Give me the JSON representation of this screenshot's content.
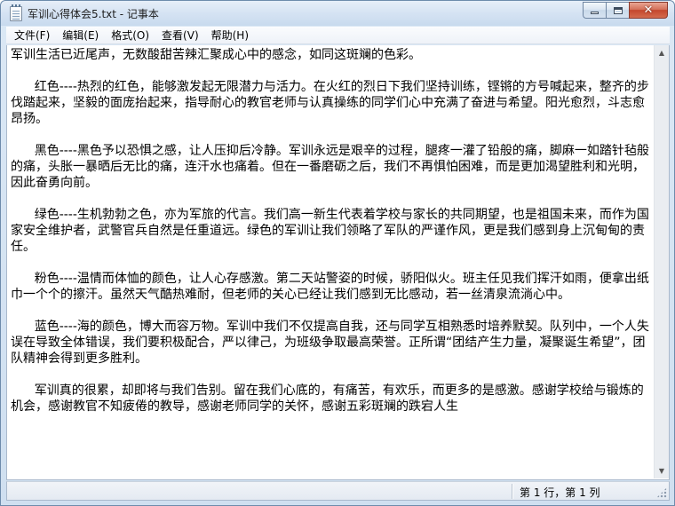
{
  "window": {
    "title": "军训心得体会5.txt - 记事本",
    "icon": "notepad-icon",
    "buttons": {
      "minimize": "minimize-icon",
      "maximize": "maximize-icon",
      "close": "close-icon"
    },
    "close_color": "#c4472d"
  },
  "menu": [
    {
      "label": "文件(F)"
    },
    {
      "label": "编辑(E)"
    },
    {
      "label": "格式(O)"
    },
    {
      "label": "查看(V)"
    },
    {
      "label": "帮助(H)"
    }
  ],
  "document": {
    "paragraphs": [
      "军训生活已近尾声，无数酸甜苦辣汇聚成心中的感念，如同这斑斓的色彩。",
      "      红色----热烈的红色，能够激发起无限潜力与活力。在火红的烈日下我们坚持训练，铿锵的方号喊起来，整齐的步伐踏起来，坚毅的面庞抬起来，指导耐心的教官老师与认真操练的同学们心中充满了奋进与希望。阳光愈烈，斗志愈昂扬。",
      "      黑色----黑色予以恐惧之感，让人压抑后冷静。军训永远是艰辛的过程，腿疼一灌了铅般的痛，脚麻一如踏针毡般的痛，头胀一暴晒后无比的痛，连汗水也痛着。但在一番磨砺之后，我们不再惧怕困难，而是更加渴望胜利和光明，因此奋勇向前。",
      "      绿色----生机勃勃之色，亦为军旅的代言。我们高一新生代表着学校与家长的共同期望，也是祖国未来，而作为国家安全维护者，武警官兵自然是任重道远。绿色的军训让我们领略了军队的严谨作风，更是我们感到身上沉甸甸的责任。",
      "      粉色----温情而体恤的颜色，让人心存感激。第二天站警姿的时候，骄阳似火。班主任见我们挥汗如雨，便拿出纸巾一个个的擦汗。虽然天气酷热难耐，但老师的关心已经让我们感到无比感动，若一丝清泉流淌心中。",
      "      蓝色----海的颜色，博大而容万物。军训中我们不仅提高自我，还与同学互相熟悉时培养默契。队列中，一个人失误在导致全体错误，我们要积极配合，严以律己，为班级争取最高荣誉。正所谓“团结产生力量，凝聚诞生希望”，团队精神会得到更多胜利。",
      "      军训真的很累，却即将与我们告别。留在我们心底的，有痛苦，有欢乐，而更多的是感激。感谢学校给与锻炼的机会，感谢教官不知疲倦的教导，感谢老师同学的关怀，感谢五彩斑斓的跌宕人生"
    ]
  },
  "status": {
    "position": "第 1 行，第 1 列"
  },
  "scrollbar": {
    "up": "scroll-up-arrow-icon",
    "down": "scroll-down-arrow-icon"
  }
}
